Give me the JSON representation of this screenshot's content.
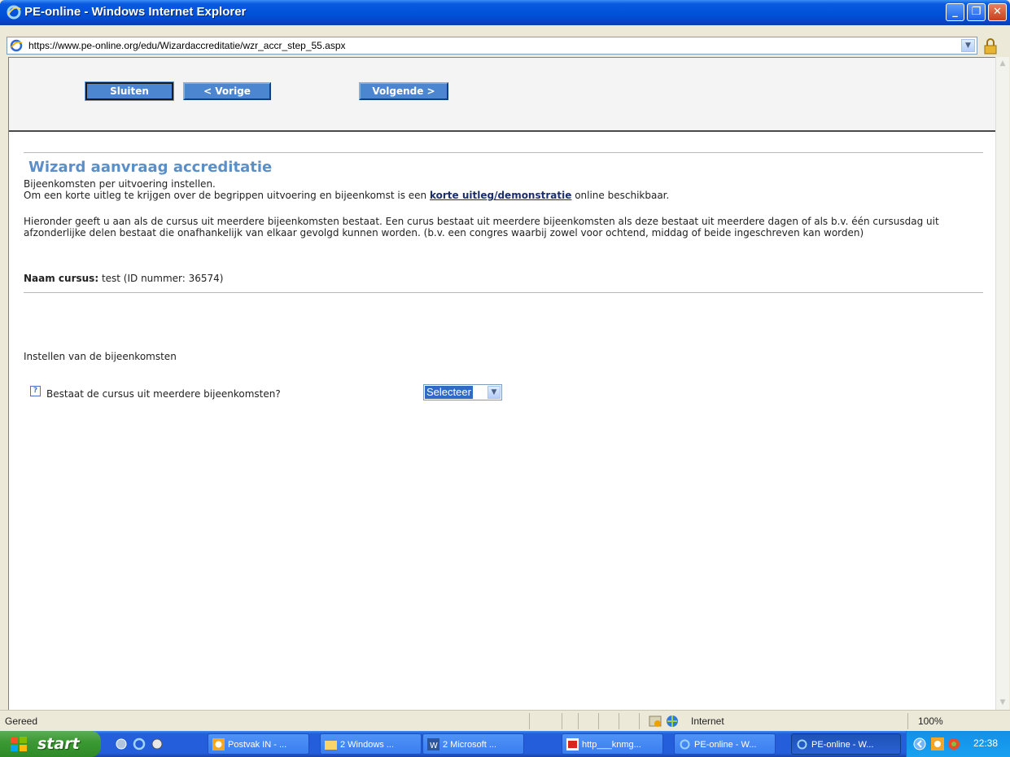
{
  "window": {
    "title": "PE-online - Windows Internet Explorer",
    "min": "_",
    "max": "❐",
    "close": "✕"
  },
  "address": {
    "url": "https://www.pe-online.org/edu/Wizardaccreditatie/wzr_accr_step_55.aspx"
  },
  "toolbar": {
    "close_label": "Sluiten",
    "prev_label": "< Vorige",
    "next_label": "Volgende >"
  },
  "page": {
    "title": "Wizard aanvraag accreditatie",
    "subtitle": "Bijeenkomsten per uitvoering instellen.",
    "intro_before": "Om een korte uitleg te krijgen over de begrippen uitvoering en bijeenkomst is een ",
    "intro_link": "korte uitleg/demonstratie",
    "intro_after": " online beschikbaar.",
    "description": "Hieronder geeft u aan als de cursus uit meerdere bijeenkomsten bestaat. Een curus bestaat uit meerdere bijeenkomsten als deze bestaat uit meerdere dagen of als b.v. één cursusdag uit afzonderlijke delen bestaat die onafhankelijk van elkaar gevolgd kunnen worden. (b.v. een congres waarbij zowel voor ochtend, middag of beide ingeschreven kan worden)",
    "course_label": "Naam cursus:",
    "course_value": " test (ID nummer: 36574)",
    "section_heading": "Instellen van de bijeenkomsten",
    "question": "Bestaat de cursus uit meerdere bijeenkomsten?",
    "select_value": "Selecteer"
  },
  "statusbar": {
    "status": "Gereed",
    "zone": "Internet",
    "zoom": "100%"
  },
  "taskbar": {
    "start_label": "start",
    "tasks": [
      {
        "label": "Postvak IN - ..."
      },
      {
        "label": "2 Windows ..."
      },
      {
        "label": "2 Microsoft ..."
      },
      {
        "label": "http___knmg..."
      },
      {
        "label": "PE-online - W..."
      },
      {
        "label": "PE-online - W..."
      }
    ],
    "clock": "22:38"
  }
}
